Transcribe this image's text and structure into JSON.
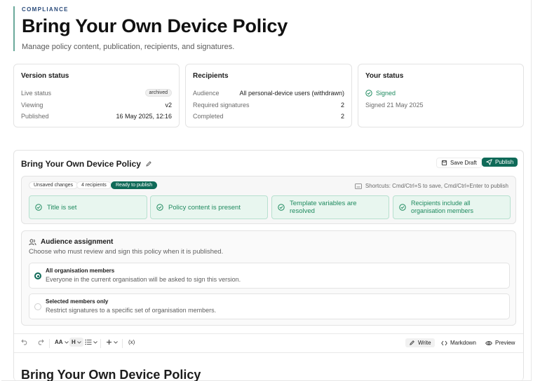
{
  "header": {
    "eyebrow": "COMPLIANCE",
    "title": "Bring Your Own Device Policy",
    "subtitle": "Manage policy content, publication, recipients, and signatures."
  },
  "version_status": {
    "title": "Version status",
    "rows": [
      {
        "label": "Live status",
        "value": "archived"
      },
      {
        "label": "Viewing",
        "value": "v2"
      },
      {
        "label": "Published",
        "value": "16 May 2025, 12:16"
      }
    ]
  },
  "recipients": {
    "title": "Recipients",
    "rows": [
      {
        "label": "Audience",
        "value": "All personal-device users (withdrawn)"
      },
      {
        "label": "Required signatures",
        "value": "2"
      },
      {
        "label": "Completed",
        "value": "2"
      }
    ]
  },
  "your_status": {
    "title": "Your status",
    "state": "Signed",
    "signed_on": "Signed 21 May 2025"
  },
  "editor": {
    "title": "Bring Your Own Device Policy",
    "save_label": "Save Draft",
    "publish_label": "Publish",
    "pills": [
      "Unsaved changes",
      "4 recipients",
      "Ready to publish"
    ],
    "shortcuts": "Shortcuts: Cmd/Ctrl+S to save, Cmd/Ctrl+Enter to publish",
    "checks": [
      "Title is set",
      "Policy content is present",
      "Template variables are resolved",
      "Recipients include all organisation members"
    ]
  },
  "audience": {
    "title": "Audience assignment",
    "subtitle": "Choose who must review and sign this policy when it is published.",
    "options": [
      {
        "title": "All organisation members",
        "desc": "Everyone in the current organisation will be asked to sign this version.",
        "selected": true
      },
      {
        "title": "Selected members only",
        "desc": "Restrict signatures to a specific set of organisation members.",
        "selected": false
      }
    ]
  },
  "toolbar": {
    "font_label": "AA",
    "heading_label": "H",
    "variable_label": "(x)",
    "write_label": "Write",
    "markdown_label": "Markdown",
    "preview_label": "Preview"
  },
  "document": {
    "heading": "Bring Your Own Device Policy"
  },
  "colors": {
    "accent": "#0f6a58",
    "success": "#1f8a5f",
    "success_bg": "#e8f6ef"
  }
}
